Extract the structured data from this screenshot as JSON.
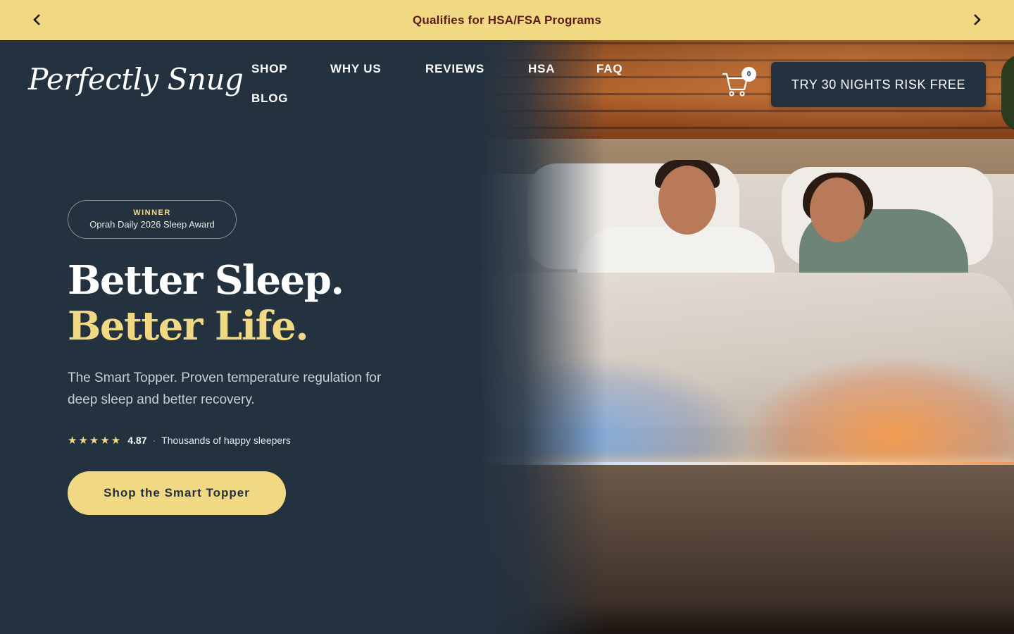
{
  "announcement": {
    "text": "Qualifies for HSA/FSA Programs",
    "prev_icon": "chevron-left-icon",
    "next_icon": "chevron-right-icon"
  },
  "header": {
    "logo": "Perfectly Snug",
    "nav": [
      "SHOP",
      "WHY US",
      "REVIEWS",
      "HSA",
      "FAQ",
      "BLOG"
    ],
    "cart_count": "0",
    "cta": "TRY 30 NIGHTS RISK FREE"
  },
  "hero": {
    "badge_title": "WINNER",
    "badge_sub": "Oprah Daily 2026 Sleep Award",
    "headline_1": "Better Sleep.",
    "headline_2": "Better Life.",
    "description": "The Smart Topper. Proven temperature regulation for deep sleep and better recovery.",
    "stars": "★★★★★",
    "rating": "4.87",
    "rating_sep": "·",
    "rating_text": "Thousands of happy sleepers",
    "button": "Shop the Smart Topper"
  },
  "colors": {
    "background": "#243240",
    "accent": "#f1d984",
    "announcement_text": "#5c1b1b"
  }
}
